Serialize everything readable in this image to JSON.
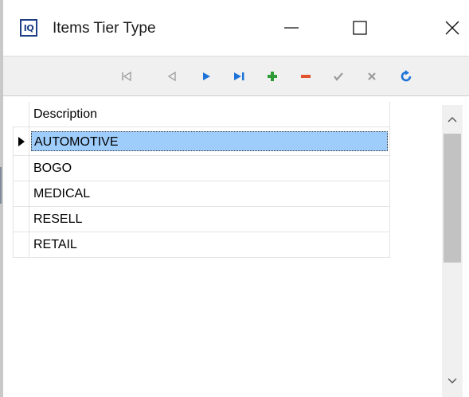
{
  "window": {
    "title": "Items Tier Type",
    "app_icon_label": "IQ",
    "controls": [
      "minimize-icon",
      "maximize-icon",
      "close-icon"
    ]
  },
  "navigator": {
    "buttons": [
      {
        "name": "first-record",
        "icon": "first-icon",
        "color": "#9a9a9a"
      },
      {
        "name": "prior-record",
        "icon": "prior-icon",
        "color": "#9a9a9a"
      },
      {
        "name": "next-record",
        "icon": "next-icon",
        "color": "#1e73d8"
      },
      {
        "name": "last-record",
        "icon": "last-icon",
        "color": "#1e73d8"
      },
      {
        "name": "insert-record",
        "icon": "plus-icon",
        "color": "#2e9b36"
      },
      {
        "name": "delete-record",
        "icon": "minus-icon",
        "color": "#e0532c"
      },
      {
        "name": "post-edit",
        "icon": "check-icon",
        "color": "#9a9a9a"
      },
      {
        "name": "cancel-edit",
        "icon": "x-icon",
        "color": "#9a9a9a"
      },
      {
        "name": "refresh-data",
        "icon": "refresh-icon",
        "color": "#1e73d8"
      }
    ]
  },
  "grid": {
    "columns": [
      "Description"
    ],
    "rows": [
      "AUTOMOTIVE",
      "BOGO",
      "MEDICAL",
      "RESELL",
      "RETAIL"
    ],
    "current_row_index": 0,
    "selection_color": "#9fcdfb"
  }
}
